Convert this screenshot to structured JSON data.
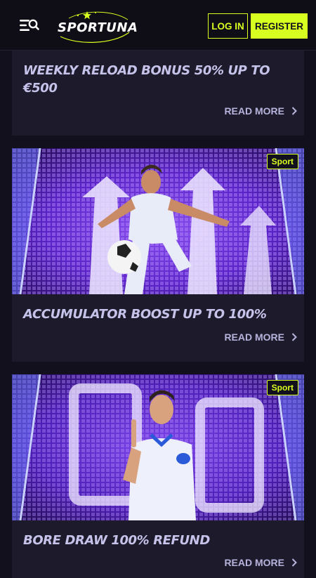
{
  "header": {
    "logo_text": "SPORTUNA",
    "login_label": "LOG IN",
    "register_label": "REGISTER"
  },
  "colors": {
    "accent": "#d7ff1f",
    "background": "#12101c",
    "card": "#1d1b2b",
    "title_text": "#c6c3ea"
  },
  "promos": [
    {
      "title": "WEEKLY RELOAD BONUS 50% UP TO €500",
      "read_more": "READ MORE"
    },
    {
      "badge": "Sport",
      "title": "ACCUMULATOR BOOST UP TO 100%",
      "read_more": "READ MORE"
    },
    {
      "badge": "Sport",
      "title": "BORE DRAW 100% REFUND",
      "read_more": "READ MORE"
    }
  ]
}
